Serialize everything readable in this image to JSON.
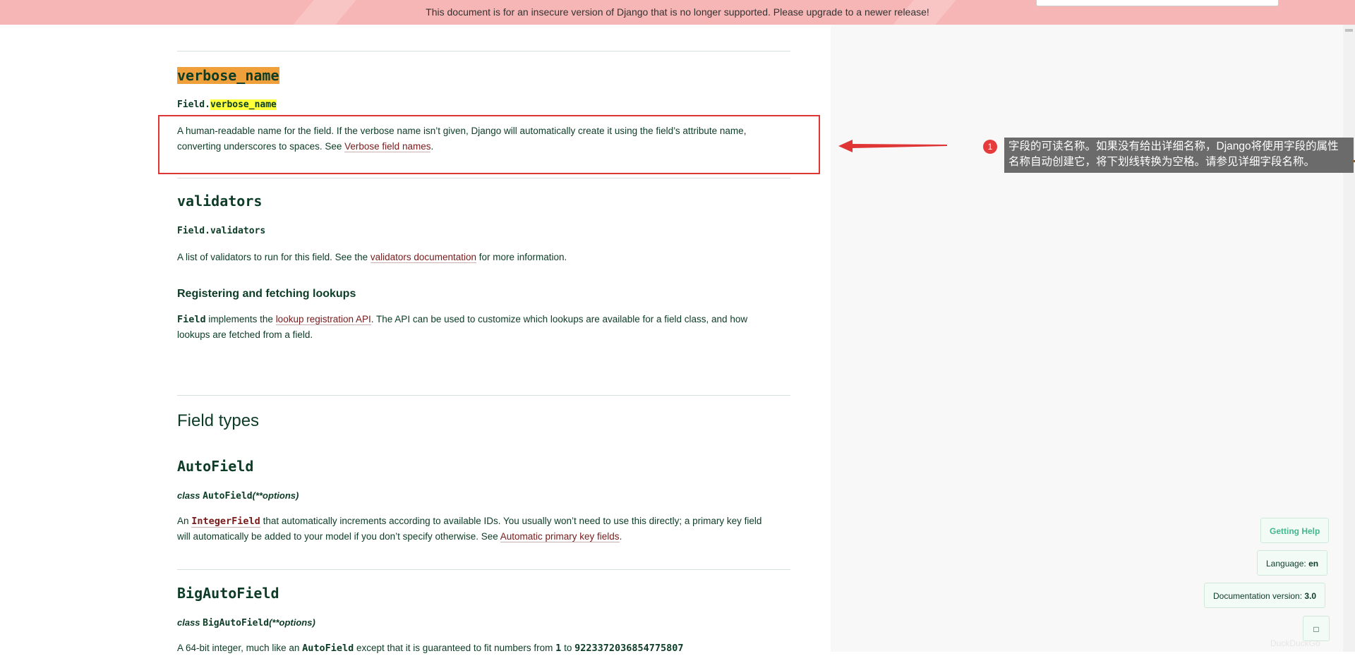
{
  "banner": {
    "text": "This document is for an insecure version of Django that is no longer supported. Please upgrade to a newer release!"
  },
  "colors": {
    "banner_bg": "#f7b6b6",
    "annotation_red": "#e03535",
    "link": "#7a1a1a",
    "text": "#0c3c26"
  },
  "sections": {
    "verbose_name": {
      "heading": "verbose_name",
      "sig_prefix": "Field.",
      "sig_name": "verbose_name",
      "p1": "A human-readable name for the field. If the verbose name isn’t given, Django will automatically create it using the field’s attribute name,",
      "p2_before": "converting underscores to spaces. See ",
      "p2_link": "Verbose field names",
      "p2_after": "."
    },
    "validators": {
      "heading": "validators",
      "sig": "Field.validators",
      "p_before": "A list of validators to run for this field. See the ",
      "p_link": "validators documentation",
      "p_after": " for more information."
    },
    "lookups": {
      "heading": "Registering and fetching lookups",
      "code": "Field",
      "p1_before": " implements the ",
      "p1_link": "lookup registration API",
      "p1_after": ". The API can be used to customize which lookups are available for a field class, and how",
      "p2": "lookups are fetched from a field."
    },
    "field_types": {
      "heading": "Field types"
    },
    "autofield": {
      "heading": "AutoField",
      "sig_class": "class ",
      "sig_name": "AutoField",
      "sig_args": "(**options)",
      "p1_a": "An ",
      "p1_code": "IntegerField",
      "p1_b": " that automatically increments according to available IDs. You usually won’t need to use this directly; a primary key field",
      "p2_before": "will automatically be added to your model if you don’t specify otherwise. See ",
      "p2_link": "Automatic primary key fields",
      "p2_after": "."
    },
    "bigautofield": {
      "heading": "BigAutoField",
      "sig_class": "class ",
      "sig_name": "BigAutoField",
      "sig_args": "(**options)",
      "p_a": "A 64-bit integer, much like an ",
      "p_code1": "AutoField",
      "p_b": " except that it is guaranteed to fit numbers from ",
      "p_code2": "1",
      "p_c": " to ",
      "p_code3": "9223372036854775807"
    }
  },
  "annotation": {
    "badge": "1",
    "tooltip": "字段的可读名称。如果没有给出详细名称，Django将使用字段的属性名称自动创建它，将下划线转换为空格。请参见详细字段名称。"
  },
  "sidebar_buttons": {
    "help": "Getting Help",
    "language_label": "Language: ",
    "language_value": "en",
    "version_label": "Documentation version: ",
    "version_value": "3.0",
    "icon": "□"
  },
  "watermark": "DuckDuckGo"
}
